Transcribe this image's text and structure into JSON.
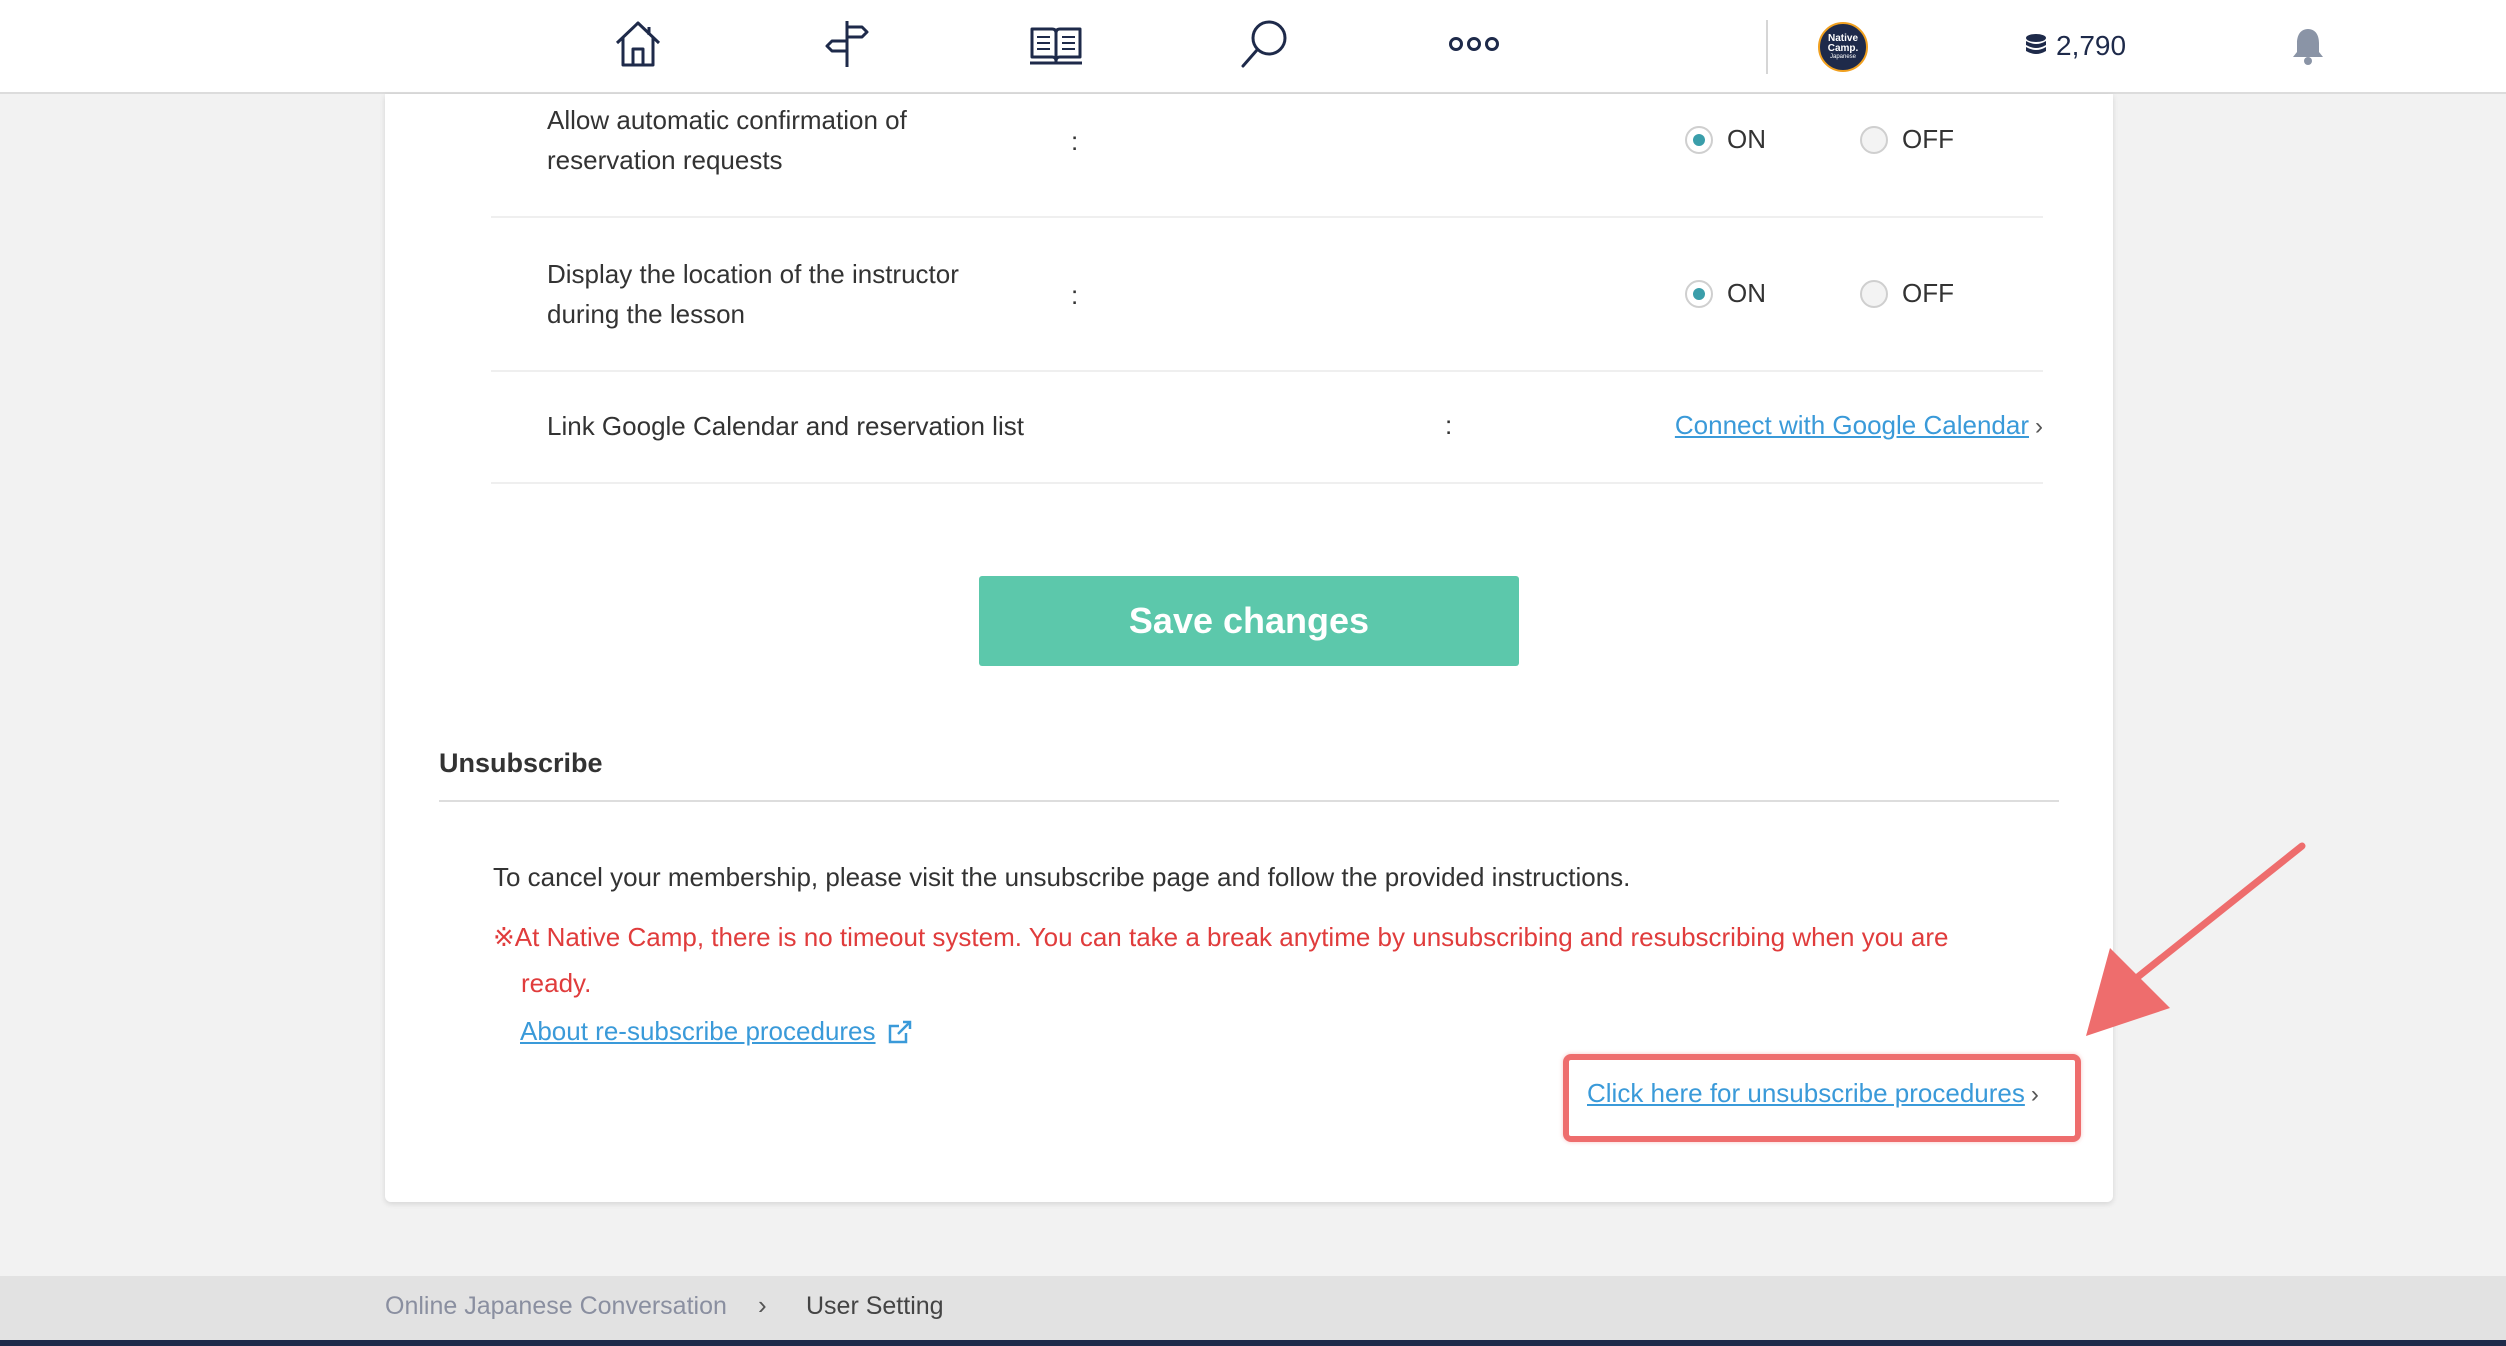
{
  "topbar": {
    "icons": [
      "home-icon",
      "signpost-icon",
      "book-icon",
      "search-icon",
      "more-icon"
    ],
    "avatar": {
      "line1": "Native",
      "line2": "Camp.",
      "line3": "Japanese"
    },
    "coins": "2,790"
  },
  "settings": [
    {
      "label": "Allow automatic confirmation of reservation requests",
      "colon": ":",
      "on_label": "ON",
      "off_label": "OFF",
      "selected": "ON"
    },
    {
      "label": "Display the location of the instructor during the lesson",
      "colon": ":",
      "on_label": "ON",
      "off_label": "OFF",
      "selected": "ON"
    },
    {
      "label": "Link Google Calendar and reservation list",
      "colon": ":",
      "link": "Connect with Google Calendar"
    }
  ],
  "save_button": "Save changes",
  "unsubscribe": {
    "title": "Unsubscribe",
    "text": "To cancel your membership, please visit the unsubscribe page and follow the provided instructions.",
    "note_line1": "※At Native Camp, there is no timeout system. You can take a break anytime by unsubscribing and resubscribing when you are",
    "note_line2": "ready.",
    "resub_link": "About re-subscribe procedures",
    "procedure_link": "Click here for unsubscribe procedures"
  },
  "breadcrumb": {
    "home": "Online Japanese Conversation",
    "separator": "›",
    "current": "User Setting"
  },
  "colors": {
    "accent_green": "#5cc8ab",
    "link_blue": "#3a9ad9",
    "warning_red": "#e03c3c",
    "annotation_red": "#ee6d6d",
    "navy": "#1e2a4a"
  }
}
